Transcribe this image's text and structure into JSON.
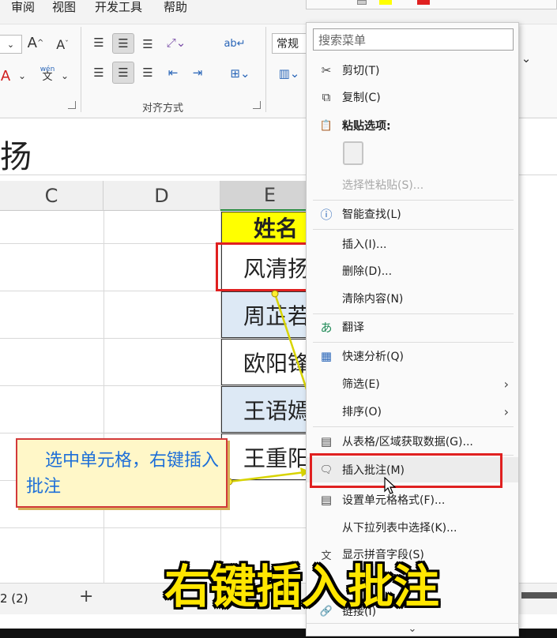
{
  "ribbon": {
    "tabs": [
      "审阅",
      "视图",
      "开发工具",
      "帮助"
    ],
    "font_size_value": "",
    "number_format": "常规",
    "alignment_group_label": "对齐方式",
    "wen_label": "wén"
  },
  "formula_bar": {
    "value": "扬"
  },
  "grid": {
    "columns": [
      "C",
      "D",
      "E"
    ],
    "header_cell": "姓名",
    "names": [
      "风清扬",
      "周芷若",
      "欧阳锋",
      "王语嫣",
      "王重阳"
    ],
    "colors": {
      "header_fill": "#ffff00",
      "name_fill": "#dde9f5"
    }
  },
  "sheetbar": {
    "tab": "2 (2)",
    "add": "+"
  },
  "callout": {
    "text": "选中单元格，右键插入批注"
  },
  "context_menu": {
    "search_placeholder": "搜索菜单",
    "items": [
      {
        "label": "剪切(T)",
        "icon": "scissors-icon",
        "glyph": "✂"
      },
      {
        "label": "复制(C)",
        "icon": "copy-icon",
        "glyph": "⧉"
      },
      {
        "label": "粘贴选项:",
        "icon": "paste-icon",
        "glyph": "📋"
      },
      {
        "label": "选择性粘贴(S)...",
        "icon": "",
        "glyph": ""
      },
      {
        "label": "智能查找(L)",
        "icon": "smart-lookup-icon",
        "glyph": "ⓘ"
      },
      {
        "label": "插入(I)...",
        "icon": "",
        "glyph": ""
      },
      {
        "label": "删除(D)...",
        "icon": "",
        "glyph": ""
      },
      {
        "label": "清除内容(N)",
        "icon": "",
        "glyph": ""
      },
      {
        "label": "翻译",
        "icon": "translate-icon",
        "glyph": "あ"
      },
      {
        "label": "快速分析(Q)",
        "icon": "quick-analysis-icon",
        "glyph": "▦"
      },
      {
        "label": "筛选(E)",
        "icon": "",
        "glyph": ""
      },
      {
        "label": "排序(O)",
        "icon": "",
        "glyph": ""
      },
      {
        "label": "从表格/区域获取数据(G)...",
        "icon": "get-data-icon",
        "glyph": "▤"
      },
      {
        "label": "插入批注(M)",
        "icon": "insert-comment-icon",
        "glyph": "🗨"
      },
      {
        "label": "设置单元格格式(F)...",
        "icon": "format-cells-icon",
        "glyph": "▤"
      },
      {
        "label": "从下拉列表中选择(K)...",
        "icon": "",
        "glyph": ""
      },
      {
        "label": "显示拼音字段(S)",
        "icon": "phonetic-icon",
        "glyph": "文"
      },
      {
        "label": "链接(I)",
        "icon": "link-icon",
        "glyph": "🔗"
      }
    ],
    "more": "⌄"
  },
  "caption": "右键插入批注"
}
